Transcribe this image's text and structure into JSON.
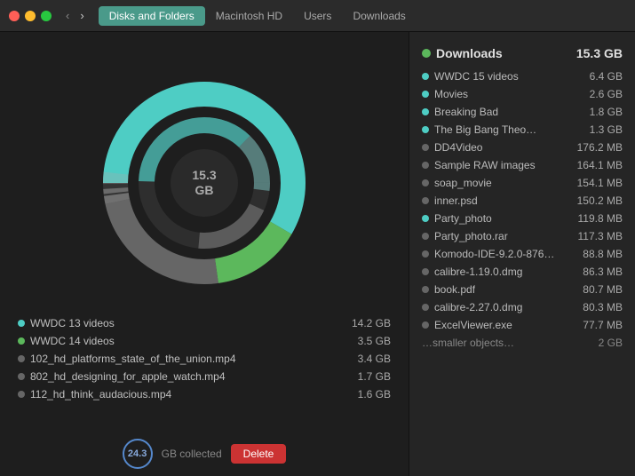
{
  "titlebar": {
    "tabs": [
      {
        "label": "Disks and Folders",
        "active": true
      },
      {
        "label": "Macintosh HD",
        "active": false
      },
      {
        "label": "Users",
        "active": false
      },
      {
        "label": "Downloads",
        "active": false
      }
    ]
  },
  "chart": {
    "center_value": "15.3",
    "center_unit": "GB"
  },
  "left_files": [
    {
      "name": "WWDC 13 videos",
      "size": "14.2 GB",
      "dot": "teal"
    },
    {
      "name": "WWDC 14 videos",
      "size": "3.5 GB",
      "dot": "green"
    },
    {
      "name": "102_hd_platforms_state_of_the_union.mp4",
      "size": "3.4 GB",
      "dot": "gray"
    },
    {
      "name": "802_hd_designing_for_apple_watch.mp4",
      "size": "1.7 GB",
      "dot": "gray"
    },
    {
      "name": "112_hd_think_audacious.mp4",
      "size": "1.6 GB",
      "dot": "gray"
    }
  ],
  "status": {
    "circle_value": "24.3",
    "text": "GB collected",
    "delete_label": "Delete"
  },
  "right_header": {
    "name": "Downloads",
    "size": "15.3 GB",
    "dot": "green"
  },
  "right_files": [
    {
      "name": "WWDC 15 videos",
      "size": "6.4 GB",
      "dot": "teal"
    },
    {
      "name": "Movies",
      "size": "2.6 GB",
      "dot": "teal"
    },
    {
      "name": "Breaking Bad",
      "size": "1.8 GB",
      "dot": "teal"
    },
    {
      "name": "The Big Bang Theo…",
      "size": "1.3 GB",
      "dot": "teal"
    },
    {
      "name": "DD4Video",
      "size": "176.2 MB",
      "dot": "gray"
    },
    {
      "name": "Sample RAW images",
      "size": "164.1 MB",
      "dot": "gray"
    },
    {
      "name": "soap_movie",
      "size": "154.1 MB",
      "dot": "gray"
    },
    {
      "name": "inner.psd",
      "size": "150.2 MB",
      "dot": "gray"
    },
    {
      "name": "Party_photo",
      "size": "119.8 MB",
      "dot": "teal"
    },
    {
      "name": "Party_photo.rar",
      "size": "117.3 MB",
      "dot": "gray"
    },
    {
      "name": "Komodo-IDE-9.2.0-876…",
      "size": "88.8 MB",
      "dot": "gray"
    },
    {
      "name": "calibre-1.19.0.dmg",
      "size": "86.3 MB",
      "dot": "gray"
    },
    {
      "name": "book.pdf",
      "size": "80.7 MB",
      "dot": "gray"
    },
    {
      "name": "calibre-2.27.0.dmg",
      "size": "80.3 MB",
      "dot": "gray"
    },
    {
      "name": "ExcelViewer.exe",
      "size": "77.7 MB",
      "dot": "gray"
    }
  ],
  "right_footer": {
    "label": "…smaller objects…",
    "size": "2 GB"
  }
}
